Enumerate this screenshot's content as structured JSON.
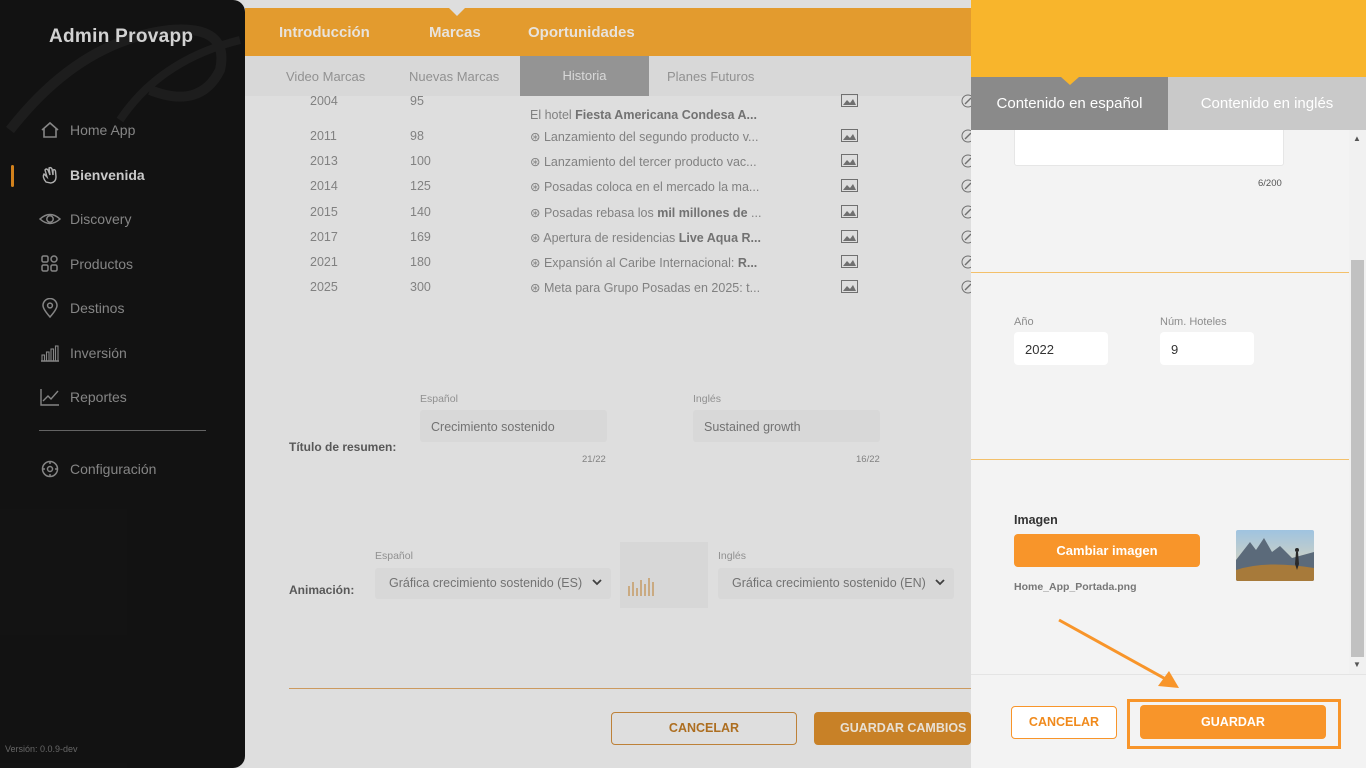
{
  "sidebar": {
    "brand": "Admin Provapp",
    "items": [
      {
        "label": "Home App",
        "icon": "home-icon",
        "active": false
      },
      {
        "label": "Bienvenida",
        "icon": "wave-hand-icon",
        "active": true
      },
      {
        "label": "Discovery",
        "icon": "eye-icon",
        "active": false
      },
      {
        "label": "Productos",
        "icon": "grid-icon",
        "active": false
      },
      {
        "label": "Destinos",
        "icon": "map-pin-icon",
        "active": false
      },
      {
        "label": "Inversión",
        "icon": "bar-chart-icon",
        "active": false
      },
      {
        "label": "Reportes",
        "icon": "line-chart-icon",
        "active": false
      }
    ],
    "config": {
      "label": "Configuración",
      "icon": "gear-icon"
    },
    "version": "Versión: 0.0.9-dev"
  },
  "topnav": {
    "tabs": [
      "Introducción",
      "Marcas",
      "Oportunidades"
    ],
    "active": "Marcas"
  },
  "subnav": {
    "tabs": [
      "Video Marcas",
      "Nuevas Marcas",
      "Historia",
      "Planes Futuros"
    ],
    "active": "Historia"
  },
  "timeline": {
    "rows": [
      {
        "year": "2004",
        "hotels": "95",
        "pre": "El hotel ",
        "bold": "Fiesta Americana Condesa A...",
        "post": ""
      },
      {
        "year": "2011",
        "hotels": "98",
        "pre": "⊛ Lanzamiento del segundo producto v...",
        "bold": "",
        "post": ""
      },
      {
        "year": "2013",
        "hotels": "100",
        "pre": "⊛ Lanzamiento del tercer producto vac...",
        "bold": "",
        "post": ""
      },
      {
        "year": "2014",
        "hotels": "125",
        "pre": "⊛ Posadas coloca en el mercado la ma...",
        "bold": "",
        "post": ""
      },
      {
        "year": "2015",
        "hotels": "140",
        "pre": "⊛ Posadas rebasa los ",
        "bold": "mil millones de",
        "post": " ..."
      },
      {
        "year": "2017",
        "hotels": "169",
        "pre": "⊛ Apertura de residencias ",
        "bold": "Live Aqua R...",
        "post": ""
      },
      {
        "year": "2021",
        "hotels": "180",
        "pre": "⊛ Expansión al Caribe Internacional: ",
        "bold": "R...",
        "post": ""
      },
      {
        "year": "2025",
        "hotels": "300",
        "pre": "⊛ Meta para Grupo Posadas en 2025: t...",
        "bold": "",
        "post": ""
      }
    ]
  },
  "summary": {
    "label": "Título de resumen:",
    "es_label": "Español",
    "es_value": "Crecimiento sostenido",
    "es_count": "21/22",
    "en_label": "Inglés",
    "en_value": "Sustained growth",
    "en_count": "16/22"
  },
  "animation": {
    "label": "Animación:",
    "es_label": "Español",
    "es_value": "Gráfica crecimiento sostenido (ES)",
    "en_label": "Inglés",
    "en_value": "Gráfica crecimiento sostenido (EN)"
  },
  "main_actions": {
    "cancel": "CANCELAR",
    "save": "GUARDAR CAMBIOS"
  },
  "panel": {
    "tabs": {
      "es": "Contenido en español",
      "en": "Contenido en inglés",
      "active": "es"
    },
    "text_count": "6/200",
    "year_label": "Año",
    "year_value": "2022",
    "hotels_label": "Núm. Hoteles",
    "hotels_value": "9",
    "image_label": "Imagen",
    "change_image": "Cambiar imagen",
    "filename": "Home_App_Portada.png",
    "cancel": "CANCELAR",
    "save": "GUARDAR"
  },
  "colors": {
    "accent": "#f8952a",
    "header": "#f8b52c",
    "sidebar": "#141414"
  }
}
